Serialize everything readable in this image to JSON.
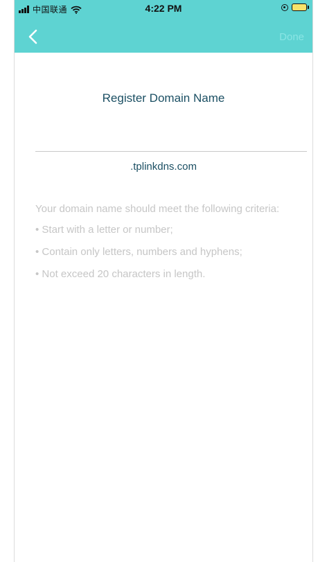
{
  "status_bar": {
    "carrier": "中国联通",
    "time": "4:22 PM",
    "icons": [
      "signal-icon",
      "wifi-icon",
      "orientation-lock-icon",
      "battery-charging-icon"
    ]
  },
  "nav": {
    "back_icon": "chevron-left-icon",
    "done_label": "Done"
  },
  "main": {
    "title": "Register Domain Name",
    "domain_input": {
      "value": "",
      "placeholder": ""
    },
    "domain_suffix": ".tplinkdns.com",
    "criteria_intro": "Your domain name should meet the following criteria:",
    "criteria_items": [
      "• Start with a letter or number;",
      "• Contain only letters, numbers and hyphens;",
      "• Not exceed 20 characters in length."
    ]
  },
  "colors": {
    "header": "#5ed3d2",
    "title_text": "#1b4f63",
    "hint_text": "#c6c6c6",
    "done_disabled": "#8ae5e4"
  }
}
